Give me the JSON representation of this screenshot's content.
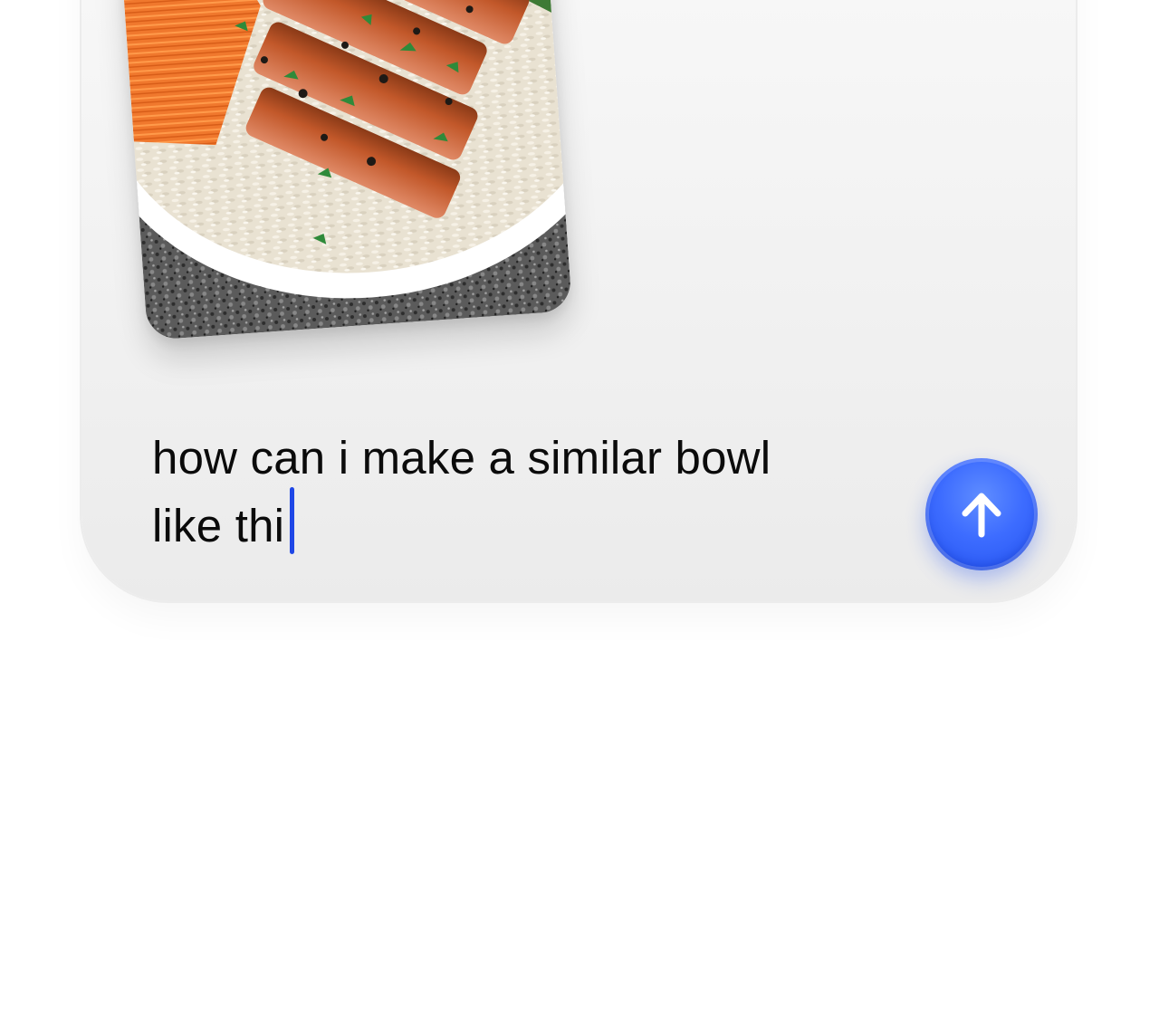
{
  "composer": {
    "prompt_lines": [
      "how can i make a similar bowl",
      "like thi"
    ],
    "send_icon": "arrow-up-icon",
    "accent_color": "#3d6cff"
  },
  "attachment": {
    "subject": "salmon rice bowl photo"
  }
}
